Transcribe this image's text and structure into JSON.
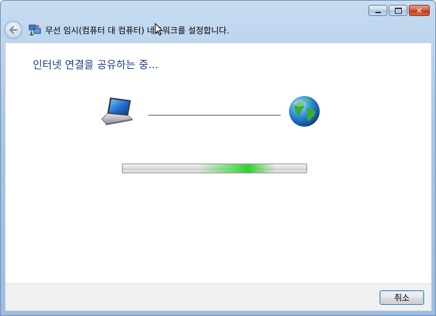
{
  "window": {
    "title": "무선 임시(컴퓨터 대 컴퓨터) 네트워크를 설정합니다.",
    "controls": {
      "minimize": "minimize-icon",
      "maximize": "maximize-icon",
      "close": "close-icon"
    }
  },
  "main": {
    "heading": "인터넷 연결을 공유하는 중...",
    "progress_fraction": 0.62
  },
  "footer": {
    "cancel_label": "취소"
  },
  "colors": {
    "heading": "#1b3e8e",
    "progress_glow": "#3cdc3c",
    "frame": "#aac6e6"
  },
  "icons": [
    "back-arrow-icon",
    "wireless-network-icon",
    "laptop-icon",
    "globe-icon",
    "mouse-cursor-icon"
  ]
}
